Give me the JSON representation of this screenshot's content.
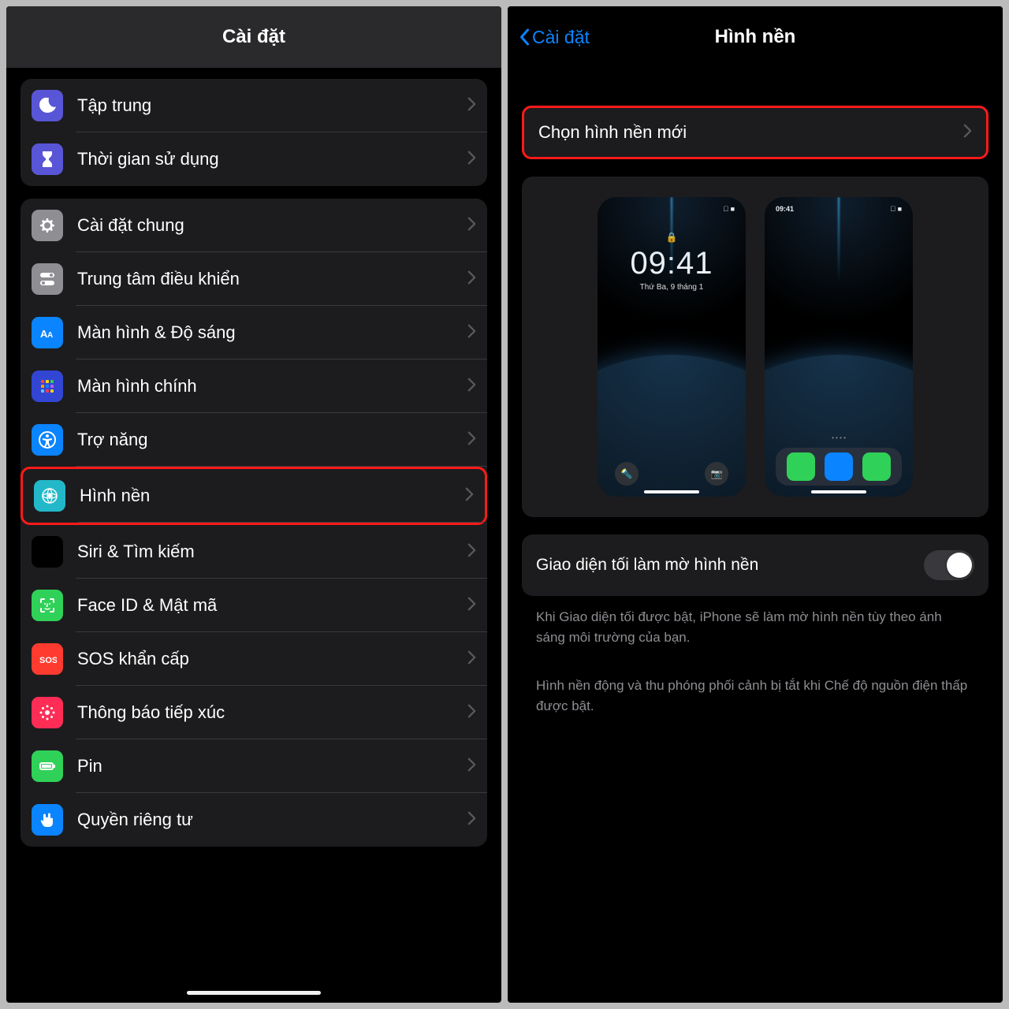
{
  "left": {
    "header": {
      "title": "Cài đặt"
    },
    "group1": [
      {
        "name": "focus-row",
        "icon": "moon-icon",
        "iconBg": "#5856d6",
        "label": "Tập trung"
      },
      {
        "name": "screentime-row",
        "icon": "hourglass-icon",
        "iconBg": "#5856d6",
        "label": "Thời gian sử dụng"
      }
    ],
    "group2": [
      {
        "name": "general-row",
        "icon": "gear-icon",
        "iconBg": "#8e8e93",
        "label": "Cài đặt chung"
      },
      {
        "name": "control-center-row",
        "icon": "toggles-icon",
        "iconBg": "#8e8e93",
        "label": "Trung tâm điều khiển"
      },
      {
        "name": "display-row",
        "icon": "aa-icon",
        "iconBg": "#0a84ff",
        "label": "Màn hình & Độ sáng"
      },
      {
        "name": "home-screen-row",
        "icon": "home-grid-icon",
        "iconBg": "#3246d3",
        "label": "Màn hình chính"
      },
      {
        "name": "accessibility-row",
        "icon": "accessibility-icon",
        "iconBg": "#0a84ff",
        "label": "Trợ năng"
      },
      {
        "name": "wallpaper-row",
        "icon": "wallpaper-icon",
        "iconBg": "#23b8c9",
        "label": "Hình nền",
        "highlight": true
      },
      {
        "name": "siri-row",
        "icon": "siri-icon",
        "iconBg": "#000000",
        "label": "Siri & Tìm kiếm"
      },
      {
        "name": "faceid-row",
        "icon": "faceid-icon",
        "iconBg": "#30d158",
        "label": "Face ID & Mật mã"
      },
      {
        "name": "sos-row",
        "icon": "sos-icon",
        "iconBg": "#ff3b30",
        "label": "SOS khẩn cấp"
      },
      {
        "name": "exposure-row",
        "icon": "exposure-icon",
        "iconBg": "#ff2d55",
        "label": "Thông báo tiếp xúc"
      },
      {
        "name": "battery-row",
        "icon": "battery-icon",
        "iconBg": "#30d158",
        "label": "Pin"
      },
      {
        "name": "privacy-row",
        "icon": "hand-icon",
        "iconBg": "#0a84ff",
        "label": "Quyền riêng tư"
      }
    ]
  },
  "right": {
    "header": {
      "back": "Cài đặt",
      "title": "Hình nền"
    },
    "choose": {
      "label": "Chọn hình nền mới"
    },
    "lock": {
      "time": "09:41",
      "date": "Thứ Ba, 9 tháng 1",
      "statusLeft": "",
      "statusRight": ""
    },
    "home": {
      "time": "09:41"
    },
    "toggle": {
      "label": "Giao diện tối làm mờ hình nền",
      "on": true
    },
    "footer1": "Khi Giao diện tối được bật, iPhone sẽ làm mờ hình nền tùy theo ánh sáng môi trường của bạn.",
    "footer2": "Hình nền động và thu phóng phối cảnh bị tắt khi Chế độ nguồn điện thấp được bật."
  }
}
